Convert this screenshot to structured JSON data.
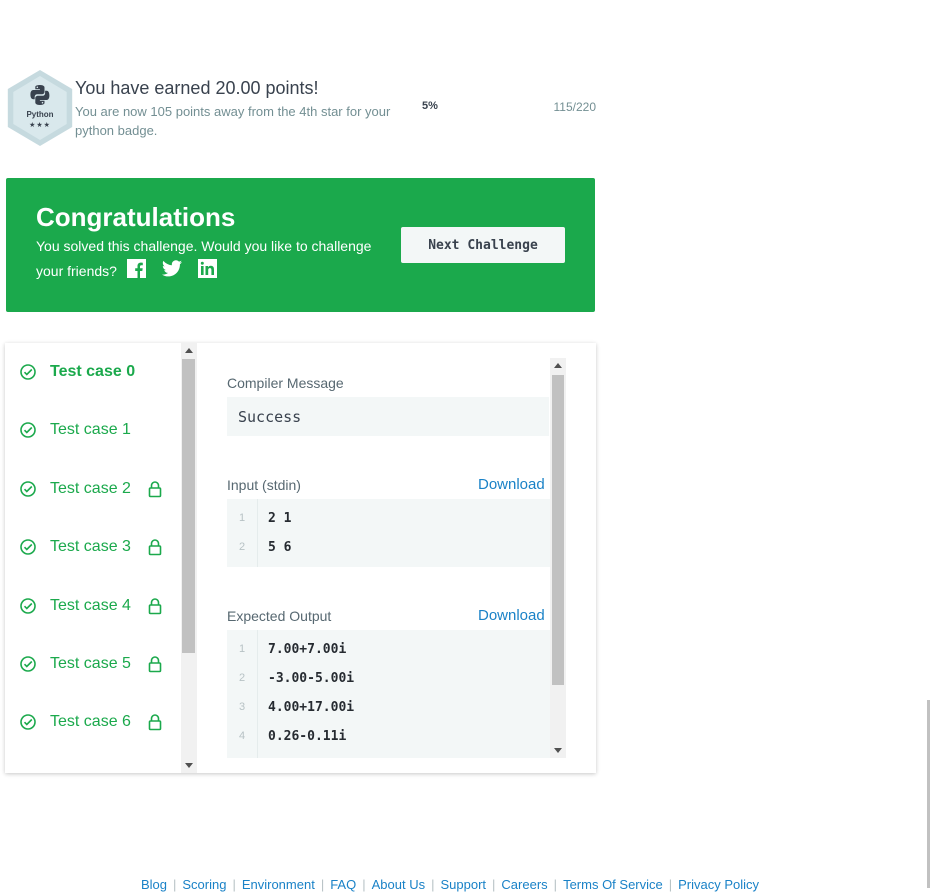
{
  "badge": {
    "name": "Python",
    "stars": "★★★",
    "earned_title": "You have earned 20.00 points!",
    "earned_sub": "You are now 105 points away from the 4th star for your python badge.",
    "progress_pct": "5%",
    "progress_count": "115/220"
  },
  "congrats": {
    "title": "Congratulations",
    "message": "You solved this challenge. Would you like to challenge your friends?",
    "next_label": "Next Challenge",
    "bg_color": "#1ba94c"
  },
  "test_cases": [
    {
      "label": "Test case 0",
      "active": true,
      "locked": false
    },
    {
      "label": "Test case 1",
      "active": false,
      "locked": false
    },
    {
      "label": "Test case 2",
      "active": false,
      "locked": true
    },
    {
      "label": "Test case 3",
      "active": false,
      "locked": true
    },
    {
      "label": "Test case 4",
      "active": false,
      "locked": true
    },
    {
      "label": "Test case 5",
      "active": false,
      "locked": true
    },
    {
      "label": "Test case 6",
      "active": false,
      "locked": true
    }
  ],
  "detail": {
    "compiler_title": "Compiler Message",
    "compiler_message": "Success",
    "input_title": "Input (stdin)",
    "input_download": "Download",
    "input_lines": [
      {
        "n": "1",
        "text": "2 1"
      },
      {
        "n": "2",
        "text": "5 6"
      }
    ],
    "expected_title": "Expected Output",
    "expected_download": "Download",
    "expected_lines": [
      {
        "n": "1",
        "text": "7.00+7.00i"
      },
      {
        "n": "2",
        "text": "-3.00-5.00i"
      },
      {
        "n": "3",
        "text": "4.00+17.00i"
      },
      {
        "n": "4",
        "text": "0.26-0.11i"
      }
    ]
  },
  "footer": {
    "links": [
      "Blog",
      "Scoring",
      "Environment",
      "FAQ",
      "About Us",
      "Support",
      "Careers",
      "Terms Of Service",
      "Privacy Policy"
    ]
  }
}
